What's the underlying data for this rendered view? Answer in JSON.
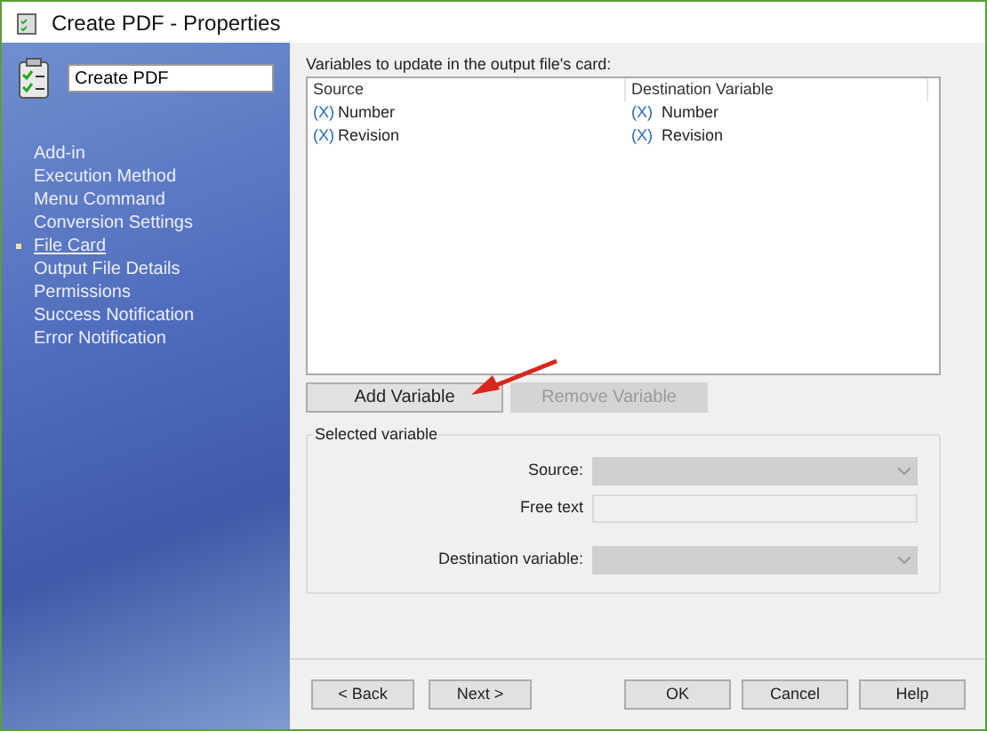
{
  "window": {
    "title": "Create PDF - Properties"
  },
  "sidebar": {
    "name_field": {
      "value": "Create PDF"
    },
    "items": [
      {
        "label": "Add-in",
        "selected": false
      },
      {
        "label": "Execution Method",
        "selected": false
      },
      {
        "label": "Menu Command",
        "selected": false
      },
      {
        "label": "Conversion Settings",
        "selected": false
      },
      {
        "label": "File Card",
        "selected": true
      },
      {
        "label": "Output File Details",
        "selected": false
      },
      {
        "label": "Permissions",
        "selected": false
      },
      {
        "label": "Success Notification",
        "selected": false
      },
      {
        "label": "Error Notification",
        "selected": false
      }
    ]
  },
  "variables": {
    "label": "Variables to update in the output file's card:",
    "columns": [
      "Source",
      "Destination Variable"
    ],
    "rows": [
      {
        "source_icon": "(X)",
        "source": "Number",
        "destination_icon": "(X)",
        "destination": "Number"
      },
      {
        "source_icon": "(X)",
        "source": "Revision",
        "destination_icon": "(X)",
        "destination": "Revision"
      }
    ]
  },
  "actions": [
    {
      "label": "Add Variable",
      "disabled": false
    },
    {
      "label": "Remove Variable",
      "disabled": true
    }
  ],
  "selected_variable": {
    "title": "Selected variable",
    "fields": [
      {
        "kind": "dropdown",
        "label": "Source:",
        "disabled": true
      },
      {
        "kind": "text",
        "label": "Free text",
        "disabled": true
      },
      {
        "kind": "dropdown",
        "label": "Destination variable:",
        "disabled": true
      }
    ]
  },
  "footer": {
    "buttons": [
      {
        "label": "< Back"
      },
      {
        "label": "Next >"
      },
      {
        "label": "OK"
      },
      {
        "label": "Cancel"
      },
      {
        "label": "Help"
      }
    ]
  }
}
